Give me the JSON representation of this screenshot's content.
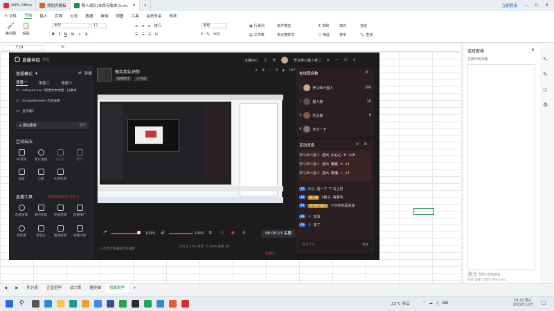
{
  "wps": {
    "tabs": [
      {
        "label": "WPS Office"
      },
      {
        "label": "找稻壳模板"
      },
      {
        "label": "猴人战队(未保存版本)1.xls"
      }
    ],
    "login": "立即登录",
    "menu": [
      "三 文件",
      "开始",
      "插入",
      "页面",
      "公式",
      "数据",
      "审阅",
      "视图",
      "工具",
      "会员专享",
      "效率"
    ],
    "active_menu": "开始",
    "ribbon": {
      "format_painter": "格式刷",
      "paste": "粘贴",
      "font": "宋体",
      "size": "12",
      "wrap": "换行",
      "number_format": "常规",
      "row_col": "行和列",
      "fill": "填充",
      "sort": "排序",
      "freeze": "冻结",
      "sum": "求和",
      "filter": "筛选",
      "find": "查找",
      "worksheet": "工作表",
      "conditional": "条件格式",
      "cell_style": "单元格样式"
    },
    "cell_ref": "T19",
    "fx": "fx",
    "sheet_tabs": [
      "积分表",
      "正直招呼",
      "战力表",
      "瞄英雄",
      "招募表里"
    ],
    "active_sheet": "招募表里",
    "right_panel": {
      "title": "选择窗格",
      "subtitle": "文档中的对象",
      "activate": "激活 Windows",
      "activate_sub": "转到\"设置\"以激活 Windows。"
    }
  },
  "live": {
    "brand": "直播伴侣",
    "brand_sub": "抖音",
    "topbar": {
      "host": "主播中心",
      "username": "罗马帝六猴人老二"
    },
    "left": {
      "mode": "常规模式",
      "guide": "导播",
      "scenes": [
        "场景一",
        "场景二",
        "场景三"
      ],
      "sources": [
        "notepad.exe *新建文本文档 - 记事本",
        "ImageShowwin 历史查看",
        "显示器1"
      ],
      "add_source": "+ 添加素材",
      "add_hint": "提示",
      "interaction_title": "互动玩法",
      "interaction": [
        "PK游戏",
        "观众连线",
        "聊天室",
        "猜价",
        "福袋",
        "心愿",
        "礼物投票"
      ],
      "tools_title": "直播工具",
      "tools_hint": "专属定制是折扣 全部 >",
      "tools": [
        "直播设置",
        "邀约奖励",
        "开播直播",
        "直播推广",
        "贵优惠",
        "管理员",
        "邀请投放",
        "导播大屏"
      ]
    },
    "stream": {
      "title": "很实用认识你",
      "badge1": "官网时代",
      "badge2": "人气榜",
      "stats": [
        "9",
        "0",
        "197"
      ]
    },
    "viewers": {
      "title": "在线观众数",
      "list": [
        {
          "rank": "1",
          "name": "罗马帝六猴人",
          "score": "200"
        },
        {
          "rank": "2",
          "name": "猴人族",
          "score": "10"
        },
        {
          "rank": "3",
          "name": "灰太狼",
          "score": "0"
        },
        {
          "rank": "4",
          "name": "米兰一下",
          "score": ""
        }
      ]
    },
    "chat": {
      "title": "互动消息",
      "gifts": [
        {
          "name": "罗马帝六猴人",
          "action": "送出",
          "gift": "小心心",
          "count": "x18"
        },
        {
          "name": "罗马帝六猴人",
          "action": "送出",
          "gift": "跳跳",
          "count": "x4"
        },
        {
          "name": "罗马帝六猴人",
          "action": "送出",
          "gift": "玫瑰",
          "count": "x3"
        }
      ],
      "messages": [
        {
          "level": "19",
          "name": "米伦",
          "text": "需一下 下 马上好"
        },
        {
          "level": "14",
          "name": "猴人族",
          "text": "0篇子, 等着吃"
        },
        {
          "level": "14",
          "name": "罗马帝六猴人",
          "text": "下次有奖品加油"
        },
        {
          "level": "13",
          "name": "小",
          "text": "加油"
        },
        {
          "level": "13",
          "name": "小",
          "text": "来了"
        }
      ],
      "input_placeholder": "说点什么...",
      "send": "发送"
    },
    "bottom": {
      "mic": "100%",
      "speaker": "100%",
      "timer": "00:05:13",
      "end": "关播",
      "stats": "CPU 4.17%  内存 71.66%  帧率 30",
      "warn": "不显示直播间实时画面",
      "status": "直播中"
    }
  },
  "taskbar": {
    "weather": "21°C 多云",
    "time": "19:32 周三",
    "date": "2022/11/23"
  },
  "colors": {
    "accent": "#1e8a4a",
    "live_bg": "#1c1c1f",
    "live_red": "#e8304a"
  }
}
